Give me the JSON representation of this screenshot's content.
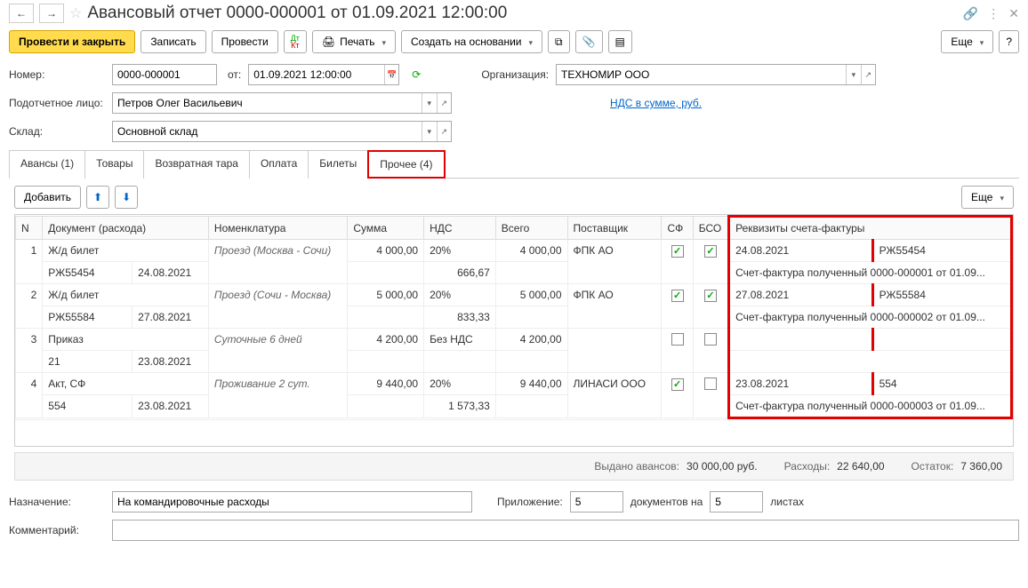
{
  "title": "Авансовый отчет 0000-000001 от 01.09.2021 12:00:00",
  "toolbar": {
    "post_close": "Провести и закрыть",
    "save": "Записать",
    "post": "Провести",
    "print": "Печать",
    "create_based": "Создать на основании",
    "more": "Еще"
  },
  "fields": {
    "number_label": "Номер:",
    "number": "0000-000001",
    "date_label": "от:",
    "date": "01.09.2021 12:00:00",
    "org_label": "Организация:",
    "org": "ТЕХНОМИР ООО",
    "person_label": "Подотчетное лицо:",
    "person": "Петров Олег Васильевич",
    "vat_link": "НДС в сумме, руб.",
    "warehouse_label": "Склад:",
    "warehouse": "Основной склад"
  },
  "tabs": {
    "advances": "Авансы (1)",
    "goods": "Товары",
    "returns": "Возвратная тара",
    "payment": "Оплата",
    "tickets": "Билеты",
    "other": "Прочее (4)"
  },
  "subtoolbar": {
    "add": "Добавить",
    "more": "Еще"
  },
  "table": {
    "headers": {
      "n": "N",
      "doc": "Документ (расхода)",
      "nomen": "Номенклатура",
      "sum": "Сумма",
      "vat": "НДС",
      "total": "Всего",
      "supplier": "Поставщик",
      "sf": "СФ",
      "bso": "БСО",
      "invoice": "Реквизиты счета-фактуры"
    },
    "rows": [
      {
        "n": "1",
        "doc1": "Ж/д билет",
        "doc2": "РЖ55454",
        "doc_date": "24.08.2021",
        "nomen": "Проезд (Москва - Сочи)",
        "sum": "4 000,00",
        "vat_rate": "20%",
        "vat_sum": "666,67",
        "total": "4 000,00",
        "supplier": "ФПК АО",
        "sf": true,
        "bso": true,
        "inv_date": "24.08.2021",
        "inv_num": "РЖ55454",
        "inv_doc": "Счет-фактура полученный 0000-000001 от 01.09..."
      },
      {
        "n": "2",
        "doc1": "Ж/д билет",
        "doc2": "РЖ55584",
        "doc_date": "27.08.2021",
        "nomen": "Проезд (Сочи - Москва)",
        "sum": "5 000,00",
        "vat_rate": "20%",
        "vat_sum": "833,33",
        "total": "5 000,00",
        "supplier": "ФПК АО",
        "sf": true,
        "bso": true,
        "inv_date": "27.08.2021",
        "inv_num": "РЖ55584",
        "inv_doc": "Счет-фактура полученный 0000-000002 от 01.09..."
      },
      {
        "n": "3",
        "doc1": "Приказ",
        "doc2": "21",
        "doc_date": "23.08.2021",
        "nomen": "Суточные 6 дней",
        "sum": "4 200,00",
        "vat_rate": "Без НДС",
        "vat_sum": "",
        "total": "4 200,00",
        "supplier": "",
        "sf": false,
        "bso": false,
        "inv_date": "",
        "inv_num": "",
        "inv_doc": ""
      },
      {
        "n": "4",
        "doc1": "Акт, СФ",
        "doc2": "554",
        "doc_date": "23.08.2021",
        "nomen": "Проживание 2 сут.",
        "sum": "9 440,00",
        "vat_rate": "20%",
        "vat_sum": "1 573,33",
        "total": "9 440,00",
        "supplier": "ЛИНАСИ ООО",
        "sf": true,
        "bso": false,
        "inv_date": "23.08.2021",
        "inv_num": "554",
        "inv_doc": "Счет-фактура полученный 0000-000003 от 01.09..."
      }
    ]
  },
  "totals": {
    "advances_label": "Выдано авансов:",
    "advances": "30 000,00",
    "cur": "руб.",
    "expenses_label": "Расходы:",
    "expenses": "22 640,00",
    "balance_label": "Остаток:",
    "balance": "7 360,00"
  },
  "footer": {
    "purpose_label": "Назначение:",
    "purpose": "На командировочные расходы",
    "attach_label": "Приложение:",
    "attach_docs": "5",
    "attach_docs_label": "документов на",
    "attach_sheets": "5",
    "attach_sheets_label": "листах",
    "comment_label": "Комментарий:"
  }
}
